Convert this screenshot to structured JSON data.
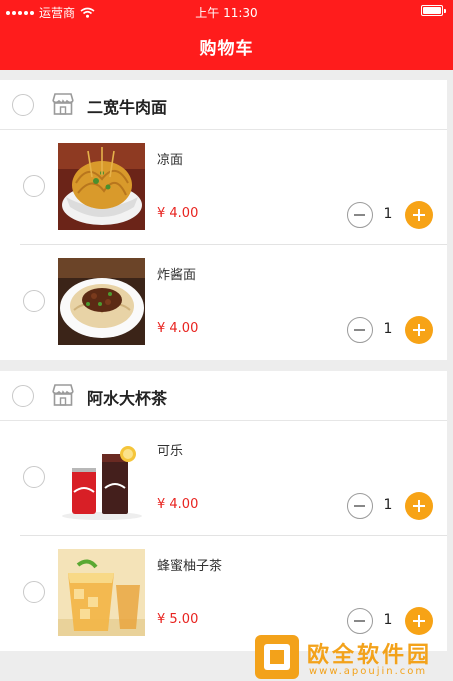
{
  "status_bar": {
    "carrier": "运营商",
    "time": "上午 11:30"
  },
  "nav": {
    "title": "购物车"
  },
  "shops": [
    {
      "name": "二宽牛肉面",
      "items": [
        {
          "name": "凉面",
          "price": "¥ 4.00",
          "quantity": "1"
        },
        {
          "name": "炸酱面",
          "price": "¥ 4.00",
          "quantity": "1"
        }
      ]
    },
    {
      "name": "阿水大杯茶",
      "items": [
        {
          "name": "可乐",
          "price": "¥ 4.00",
          "quantity": "1"
        },
        {
          "name": "蜂蜜柚子茶",
          "price": "¥ 5.00",
          "quantity": "1"
        }
      ]
    }
  ],
  "watermark": {
    "title": "欧全软件园",
    "url": "www.apoujin.com"
  },
  "colors": {
    "nav_background": "#ff1c1c",
    "price": "#e8231f",
    "plus_button": "#f7a316"
  },
  "icons": {
    "shop": "shop-icon",
    "minus": "minus-icon",
    "plus": "plus-icon"
  }
}
